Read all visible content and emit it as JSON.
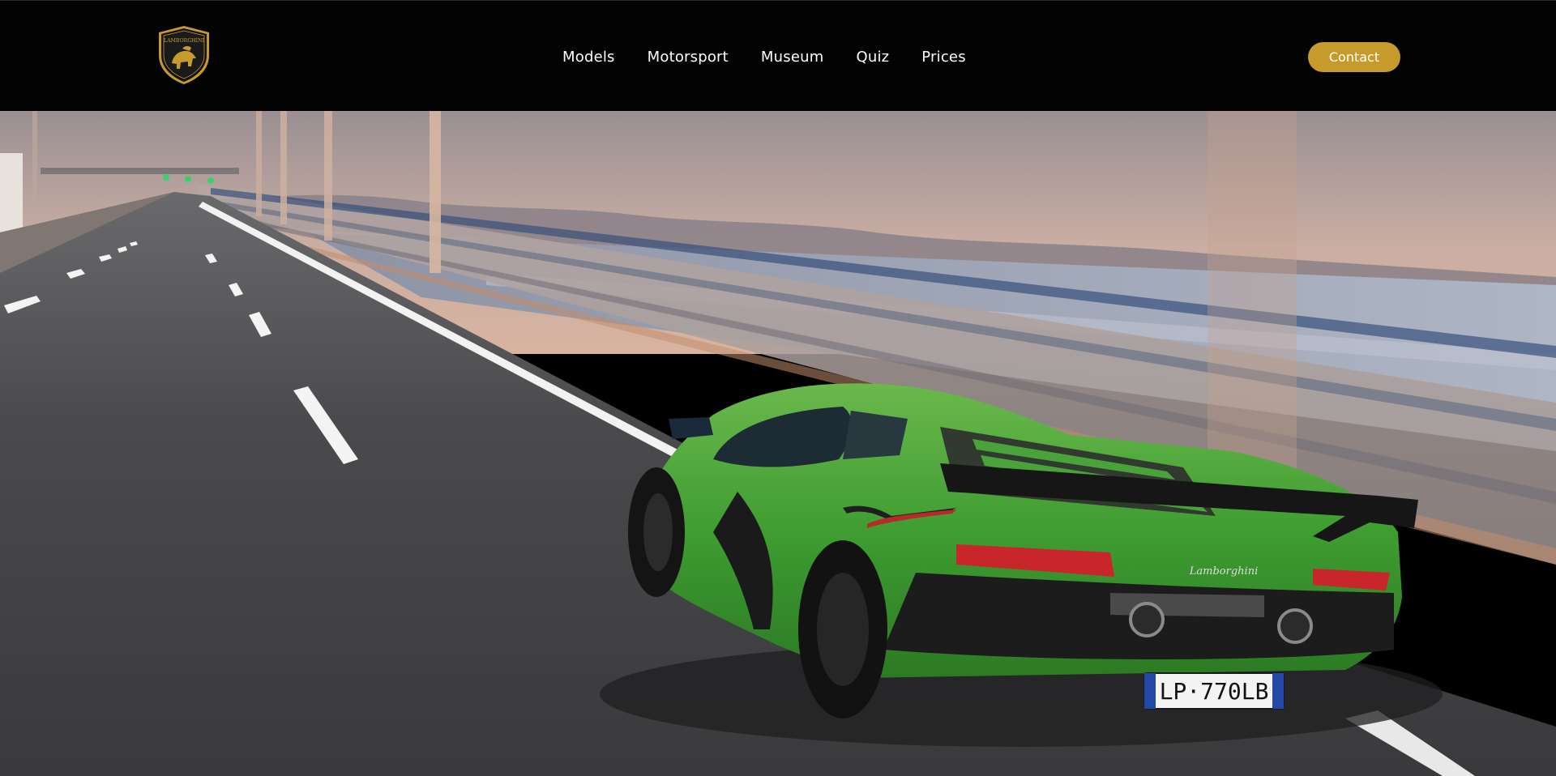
{
  "brand": {
    "logo_text": "LAMBORGHINI",
    "accent_color": "#c79a2c"
  },
  "nav": {
    "items": [
      {
        "label": "Models"
      },
      {
        "label": "Motorsport"
      },
      {
        "label": "Museum"
      },
      {
        "label": "Quiz"
      },
      {
        "label": "Prices"
      }
    ]
  },
  "header": {
    "contact_label": "Contact"
  },
  "hero": {
    "license_plate": "LP·770LB",
    "car_badge": "Lamborghini"
  }
}
